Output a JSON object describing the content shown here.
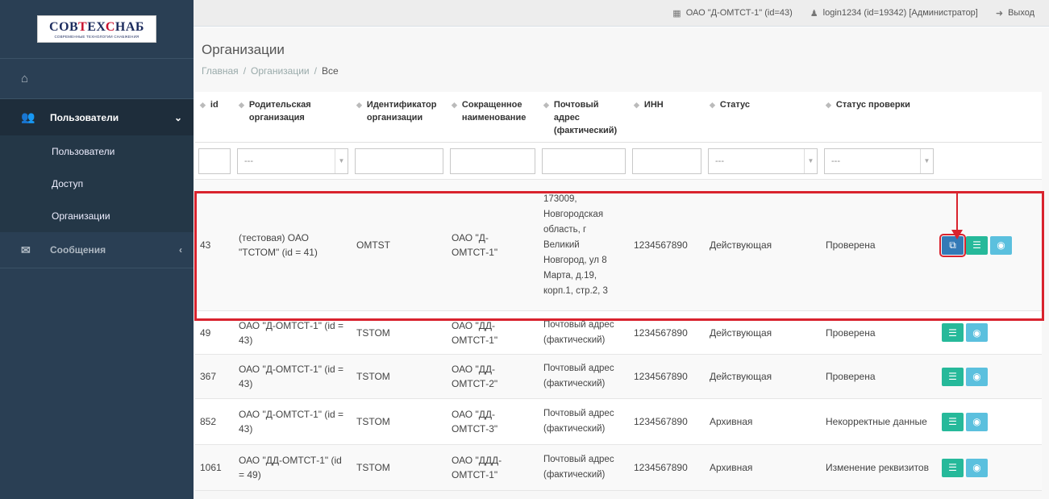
{
  "logo": {
    "main_a": "СОВ",
    "main_b": "Т",
    "main_c": "ЕХ",
    "main_d": "С",
    "main_e": "НАБ",
    "sub": "СОВРЕМЕННЫЕ ТЕХНОЛОГИИ СНАБЖЕНИЯ"
  },
  "sidebar": {
    "users_label": "Пользователи",
    "sub_items": [
      "Пользователи",
      "Доступ",
      "Организации"
    ],
    "messages_label": "Сообщения"
  },
  "topbar": {
    "org": "ОАО \"Д-ОМТСТ-1\" (id=43)",
    "user": "login1234 (id=19342) [Администратор]",
    "logout": "Выход"
  },
  "page": {
    "title": "Организации",
    "breadcrumb": [
      "Главная",
      "Организации",
      "Все"
    ]
  },
  "table": {
    "headers": [
      "id",
      "Родительская организация",
      "Идентификатор организации",
      "Сокращенное наименование",
      "Почтовый адрес (фактический)",
      "ИНН",
      "Статус",
      "Статус проверки"
    ],
    "filter_placeholder": "---",
    "rows": [
      {
        "id": "43",
        "parent": "(тестовая) ОАО \"ТСТОМ\" (id = 41)",
        "ident": "OMTST",
        "short": "ОАО \"Д-ОМТСТ-1\"",
        "addr": "173009, Новгородская область, г Великий Новгород, ул 8 Марта, д.19, корп.1, стр.2, 3",
        "inn": "1234567890",
        "status": "Действующая",
        "check": "Проверена"
      },
      {
        "id": "49",
        "parent": "ОАО \"Д-ОМТСТ-1\" (id = 43)",
        "ident": "TSTOM",
        "short": "ОАО \"ДД-ОМТСТ-1\"",
        "addr": "Почтовый адрес (фактический)",
        "inn": "1234567890",
        "status": "Действующая",
        "check": "Проверена"
      },
      {
        "id": "367",
        "parent": "ОАО \"Д-ОМТСТ-1\" (id = 43)",
        "ident": "TSTOM",
        "short": "ОАО \"ДД-ОМТСТ-2\"",
        "addr": "Почтовый адрес (фактический)",
        "inn": "1234567890",
        "status": "Действующая",
        "check": "Проверена"
      },
      {
        "id": "852",
        "parent": "ОАО \"Д-ОМТСТ-1\" (id = 43)",
        "ident": "TSTOM",
        "short": "ОАО \"ДД-ОМТСТ-3\"",
        "addr": "Почтовый адрес (фактический)",
        "inn": "1234567890",
        "status": "Архивная",
        "check": "Некорректные данные"
      },
      {
        "id": "1061",
        "parent": "ОАО \"ДД-ОМТСТ-1\" (id = 49)",
        "ident": "TSTOM",
        "short": "ОАО \"ДДД-ОМТСТ-1\"",
        "addr": "Почтовый адрес (фактический)",
        "inn": "1234567890",
        "status": "Архивная",
        "check": "Изменение реквизитов"
      }
    ]
  }
}
